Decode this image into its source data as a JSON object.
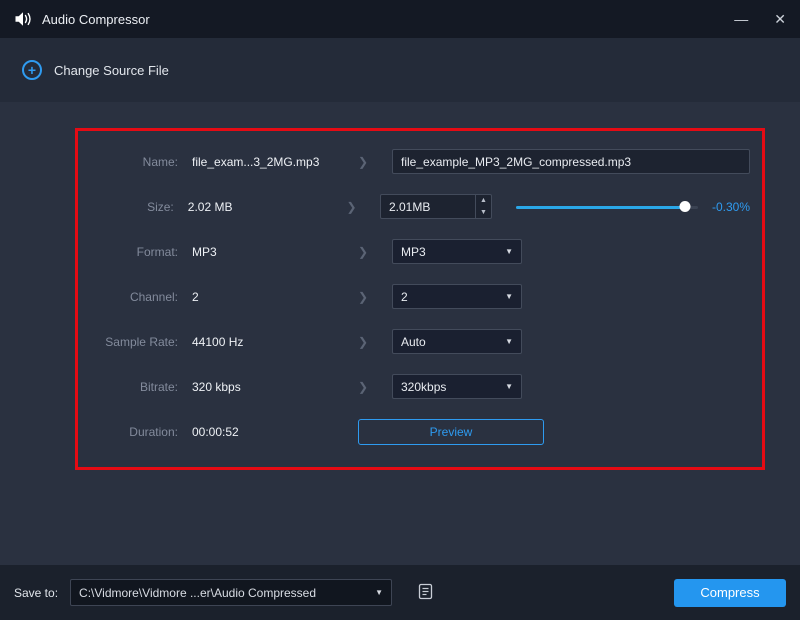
{
  "titlebar": {
    "title": "Audio Compressor"
  },
  "toolbar": {
    "change_source_label": "Change Source File"
  },
  "panel": {
    "rows": {
      "name": {
        "label": "Name:",
        "value": "file_exam...3_2MG.mp3",
        "output": "file_example_MP3_2MG_compressed.mp3"
      },
      "size": {
        "label": "Size:",
        "value": "2.02 MB",
        "output": "2.01MB",
        "ratio_label": "-0.30%",
        "slider_percent": 93
      },
      "format": {
        "label": "Format:",
        "value": "MP3",
        "output": "MP3"
      },
      "channel": {
        "label": "Channel:",
        "value": "2",
        "output": "2"
      },
      "sample_rate": {
        "label": "Sample Rate:",
        "value": "44100 Hz",
        "output": "Auto"
      },
      "bitrate": {
        "label": "Bitrate:",
        "value": "320 kbps",
        "output": "320kbps"
      },
      "duration": {
        "label": "Duration:",
        "value": "00:00:52",
        "preview_label": "Preview"
      }
    }
  },
  "footer": {
    "save_to_label": "Save to:",
    "path": "C:\\Vidmore\\Vidmore ...er\\Audio Compressed",
    "compress_label": "Compress"
  },
  "icons": {
    "plus": "+",
    "chevron_right": "❯",
    "caret_down": "▼",
    "spinner_up": "▲",
    "spinner_down": "▼",
    "minimize": "—",
    "close": "✕"
  },
  "colors": {
    "accent": "#2f9bf0",
    "highlight_border": "#e50b14",
    "slider_fill": "#2aa7e8"
  }
}
